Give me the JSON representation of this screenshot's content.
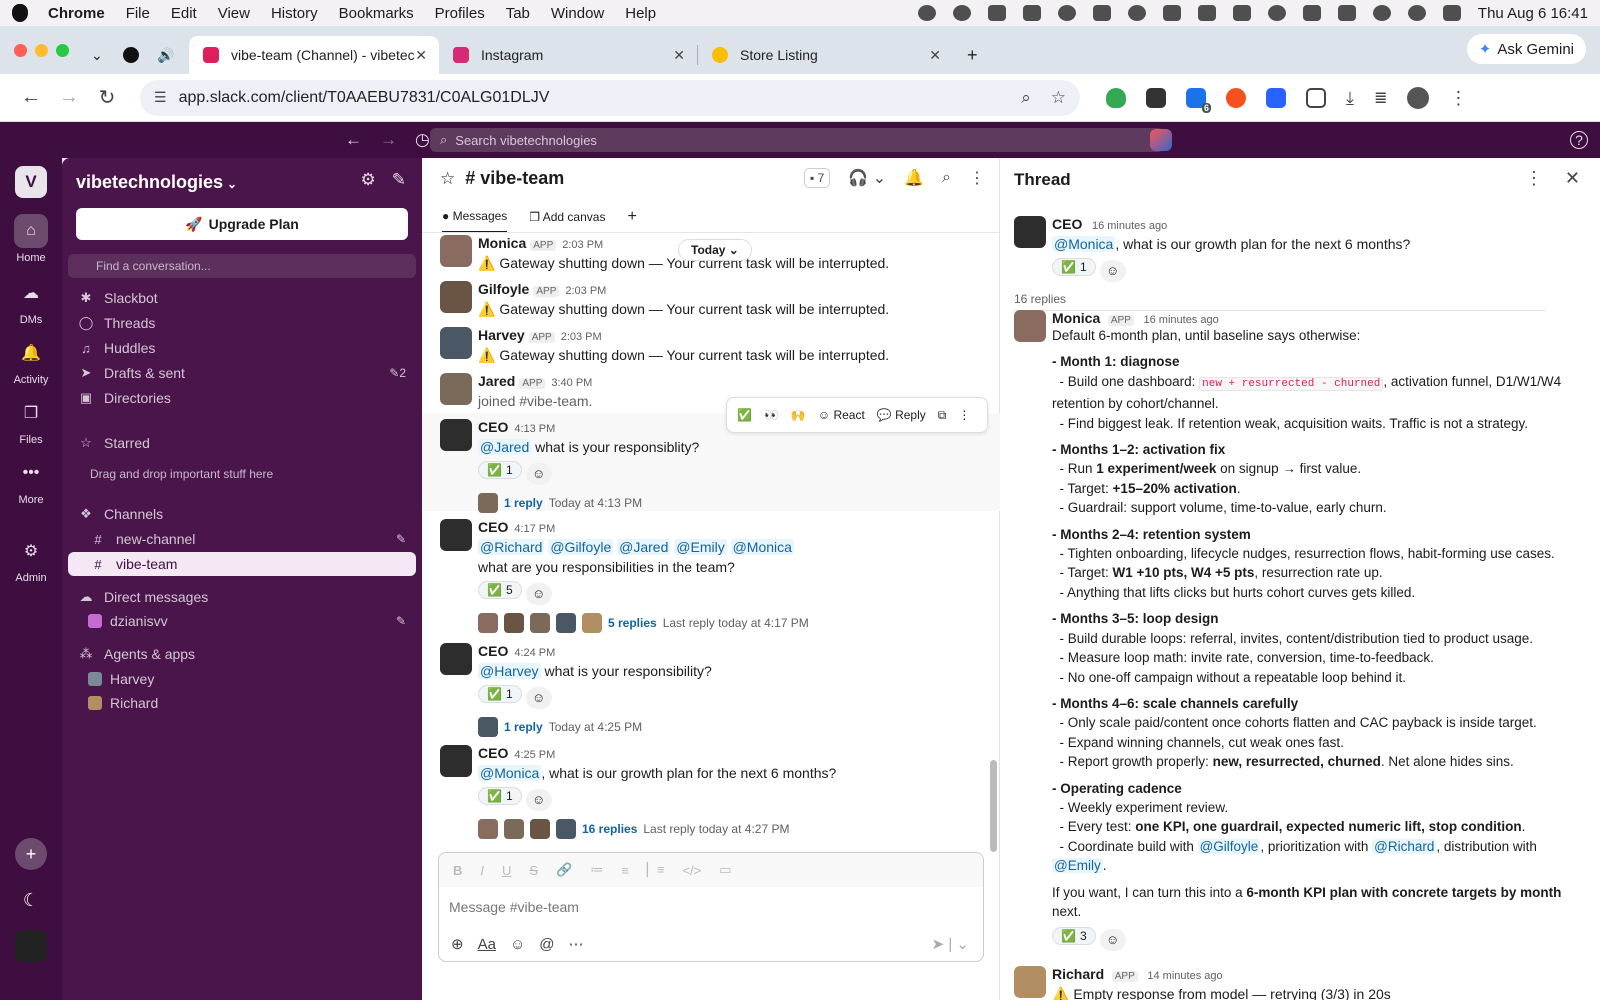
{
  "os": {
    "app_name": "Chrome",
    "menu": [
      "File",
      "Edit",
      "View",
      "History",
      "Bookmarks",
      "Profiles",
      "Tab",
      "Window",
      "Help"
    ],
    "clock": "Thu Aug 6  16:41"
  },
  "browser": {
    "tabs": [
      {
        "title": "vibe-team (Channel) - vibetec",
        "active": true
      },
      {
        "title": "Instagram"
      },
      {
        "title": "Store Listing"
      }
    ],
    "ask_gemini": "Ask Gemini",
    "url": "app.slack.com/client/T0AAEBU7831/C0ALG01DLJV",
    "ext_badge": "6"
  },
  "slack": {
    "search_placeholder": "Search vibetechnologies",
    "workspace_initial": "V",
    "rail": [
      "Home",
      "DMs",
      "Activity",
      "Files",
      "More",
      "Admin"
    ],
    "sidebar": {
      "workspace": "vibetechnologies",
      "upgrade": "Upgrade Plan",
      "find_placeholder": "Find a conversation...",
      "items": [
        "Slackbot",
        "Threads",
        "Huddles",
        "Drafts & sent",
        "Directories"
      ],
      "drafts_count": "2",
      "starred": "Starred",
      "starred_hint": "Drag and drop important stuff here",
      "channels_header": "Channels",
      "channels": [
        "new-channel",
        "vibe-team"
      ],
      "dm_header": "Direct messages",
      "dms": [
        "dzianisvv"
      ],
      "agents_header": "Agents & apps",
      "agents": [
        "Harvey",
        "Richard"
      ]
    },
    "channel": {
      "name": "# vibe-team",
      "member_count": "7",
      "tabs": [
        "Messages",
        "Add canvas"
      ],
      "date_divider": "Today",
      "composer_placeholder": "Message #vibe-team"
    },
    "hover_toolbar": {
      "react": "React",
      "reply": "Reply"
    },
    "messages": [
      {
        "name": "Monica",
        "tag": "APP",
        "time": "2:03 PM",
        "text": "⚠️ Gateway shutting down — Your current task will be interrupted."
      },
      {
        "name": "Gilfoyle",
        "tag": "APP",
        "time": "2:03 PM",
        "text": "⚠️ Gateway shutting down — Your current task will be interrupted."
      },
      {
        "name": "Harvey",
        "tag": "APP",
        "time": "2:03 PM",
        "text": "⚠️ Gateway shutting down — Your current task will be interrupted."
      },
      {
        "name": "Jared",
        "tag": "APP",
        "time": "3:40 PM",
        "text": "joined #vibe-team."
      },
      {
        "name": "CEO",
        "time": "4:13 PM",
        "mention": "@Jared",
        "text": " what is your responsiblity?",
        "reaction": "1",
        "replies": "1 reply",
        "reply_time": "Today at 4:13 PM"
      },
      {
        "name": "CEO",
        "time": "4:17 PM",
        "mentions": [
          "@Richard",
          "@Gilfoyle",
          "@Jared",
          "@Emily",
          "@Monica"
        ],
        "text": "what are you responsibilities in the team?",
        "reaction": "5",
        "replies": "5 replies",
        "reply_time": "Last reply today at 4:17 PM"
      },
      {
        "name": "CEO",
        "time": "4:24 PM",
        "mention": "@Harvey",
        "text": " what is your responsibility?",
        "reaction": "1",
        "replies": "1 reply",
        "reply_time": "Today at 4:25 PM"
      },
      {
        "name": "CEO",
        "time": "4:25 PM",
        "mention": "@Monica",
        "text": ", what is our growth plan for the next 6 months?",
        "reaction": "1",
        "replies": "16 replies",
        "reply_time": "Last reply today at 4:27 PM"
      }
    ],
    "thread": {
      "title": "Thread",
      "root": {
        "name": "CEO",
        "time": "16 minutes ago",
        "mention": "@Monica",
        "text": ", what is our growth plan for the next 6 months?",
        "reaction": "1"
      },
      "reply_count": "16 replies",
      "reply": {
        "name": "Monica",
        "tag": "APP",
        "time": "16 minutes ago",
        "intro": "Default 6-month plan, until baseline says otherwise:",
        "m1_h": "Month 1: diagnose",
        "m1_a_pre": "- Build one dashboard: ",
        "m1_a_code": "new + resurrected - churned",
        "m1_a_post": ", activation funnel, D1/W1/W4 retention by cohort/channel.",
        "m1_b": "- Find biggest leak. If retention weak, acquisition waits. Traffic is not a strategy.",
        "m2_h": "Months 1–2: activation fix",
        "m2_a_pre": "- Run ",
        "m2_a_b": "1 experiment/week",
        "m2_a_post": " on signup → first value.",
        "m2_b_pre": "- Target: ",
        "m2_b_b": "+15–20% activation",
        "m2_b_post": ".",
        "m2_c": "- Guardrail: support volume, time-to-value, early churn.",
        "m3_h": "Months 2–4: retention system",
        "m3_a": "- Tighten onboarding, lifecycle nudges, resurrection flows, habit-forming use cases.",
        "m3_b_pre": "- Target: ",
        "m3_b_b": "W1 +10 pts, W4 +5 pts",
        "m3_b_post": ", resurrection rate up.",
        "m3_c": "- Anything that lifts clicks but hurts cohort curves gets killed.",
        "m4_h": "Months 3–5: loop design",
        "m4_a": "- Build durable loops: referral, invites, content/distribution tied to product usage.",
        "m4_b": "- Measure loop math: invite rate, conversion, time-to-feedback.",
        "m4_c": "- No one-off campaign without a repeatable loop behind it.",
        "m5_h": "Months 4–6: scale channels carefully",
        "m5_a": "- Only scale paid/content once cohorts flatten and CAC payback is inside target.",
        "m5_b": "- Expand winning channels, cut weak ones fast.",
        "m5_c_pre": "- Report growth properly: ",
        "m5_c_b": "new, resurrected, churned",
        "m5_c_post": ". Net alone hides sins.",
        "m6_h": "Operating cadence",
        "m6_a": "- Weekly experiment review.",
        "m6_b_pre": "- Every test: ",
        "m6_b_b": "one KPI, one guardrail, expected numeric lift, stop condition",
        "m6_b_post": ".",
        "m6_c_pre": "- Coordinate build with ",
        "m6_c_m1": "@Gilfoyle",
        "m6_c_mid": ", prioritization with ",
        "m6_c_m2": "@Richard",
        "m6_c_post": ", distribution with ",
        "m6_c_m3": "@Emily",
        "m6_c_end": ".",
        "outro_pre": "If you want, I can turn this into a ",
        "outro_b": "6-month KPI plan with concrete targets by month",
        "outro_post": " next.",
        "reaction": "3"
      },
      "next": {
        "name": "Richard",
        "tag": "APP",
        "time": "14 minutes ago",
        "text": "⚠️ Empty response from model — retrying (3/3) in 20s"
      }
    }
  }
}
